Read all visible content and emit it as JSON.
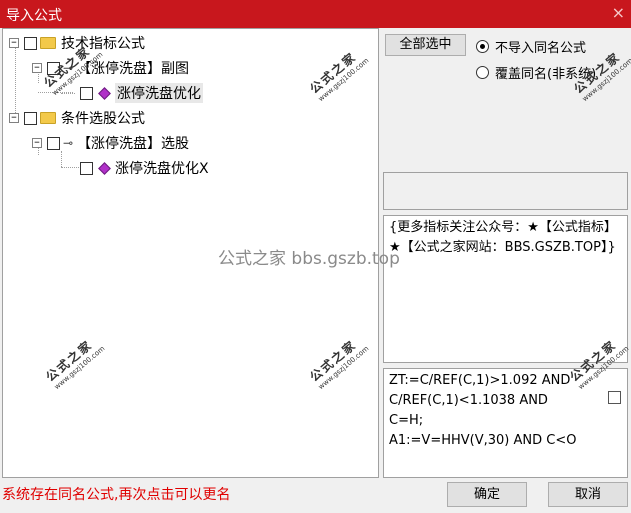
{
  "window": {
    "title": "导入公式",
    "close_glyph": "×"
  },
  "tree": {
    "nodes": [
      {
        "label": "技术指标公式",
        "icon": "folder-icon"
      },
      {
        "label": "【涨停洗盘】副图",
        "icon": "key-icon"
      },
      {
        "label": "涨停洗盘优化",
        "icon": "diamond-icon"
      },
      {
        "label": "条件选股公式",
        "icon": "folder-icon"
      },
      {
        "label": "【涨停洗盘】选股",
        "icon": "key-icon"
      },
      {
        "label": "涨停洗盘优化X",
        "icon": "diamond-icon"
      }
    ]
  },
  "options": {
    "select_all_label": "全部选中",
    "radio_no_import": "不导入同名公式",
    "radio_overwrite": "覆盖同名(非系统)",
    "selected": "不导入同名公式"
  },
  "info_text": "{更多指标关注公众号：★【公式指标】★【公式之家网站：BBS.GSZB.TOP】}",
  "formula_lines": [
    "ZT:=C/REF(C,1)>1.092 AND",
    "C/REF(C,1)<1.1038 AND",
    "C=H;",
    "A1:=V=HHV(V,30) AND C<O"
  ],
  "status_text": "系统存在同名公式,再次点击可以更名",
  "buttons": {
    "ok": "确定",
    "cancel": "取消"
  },
  "watermark": {
    "text": "公式之家 bbs.gszb.top",
    "stamp_title": "公式之家",
    "stamp_url": "www.gszj100.com"
  }
}
